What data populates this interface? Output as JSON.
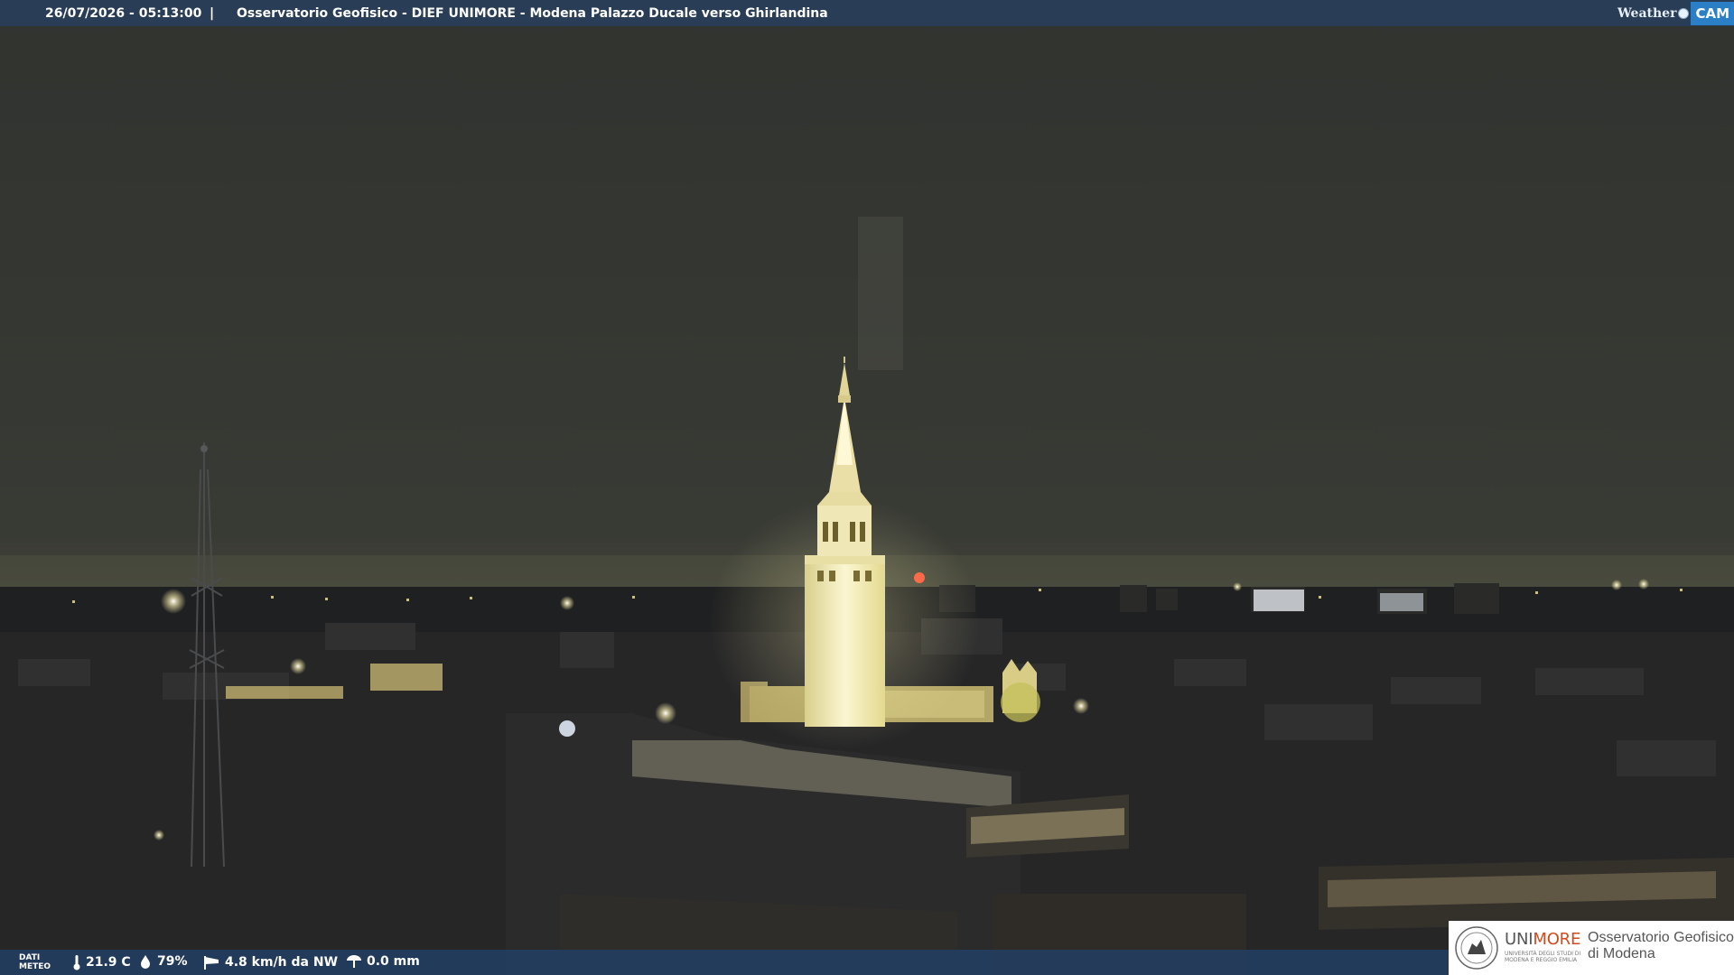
{
  "header": {
    "timestamp": "26/07/2026 - 05:13:00",
    "separator": "|",
    "caption": "Osservatorio Geofisico - DIEF UNIMORE - Modena Palazzo Ducale verso Ghirlandina"
  },
  "brand": {
    "weather_text": "Weather",
    "cam_text": "CAM",
    "accent": "#2b7fc6"
  },
  "weather_bar": {
    "label_line1": "DATI",
    "label_line2": "METEO",
    "temperature": "21.9 C",
    "humidity": "79%",
    "wind": "4.8 km/h da NW",
    "rain": "0.0 mm",
    "icons": [
      "thermometer-icon",
      "humidity-drop-icon",
      "wind-sock-icon",
      "rain-gauge-icon"
    ]
  },
  "logo": {
    "uni": "UNI",
    "more": "MORE",
    "uni_sub": "UNIVERSITÀ DEGLI STUDI DI MODENA E REGGIO EMILIA",
    "observatory_line1": "Osservatorio Geofisico",
    "observatory_line2": "di Modena"
  },
  "colors": {
    "sky": "#373a33",
    "tower_light": "#f6efc0",
    "bar_blue": "#233e60"
  }
}
